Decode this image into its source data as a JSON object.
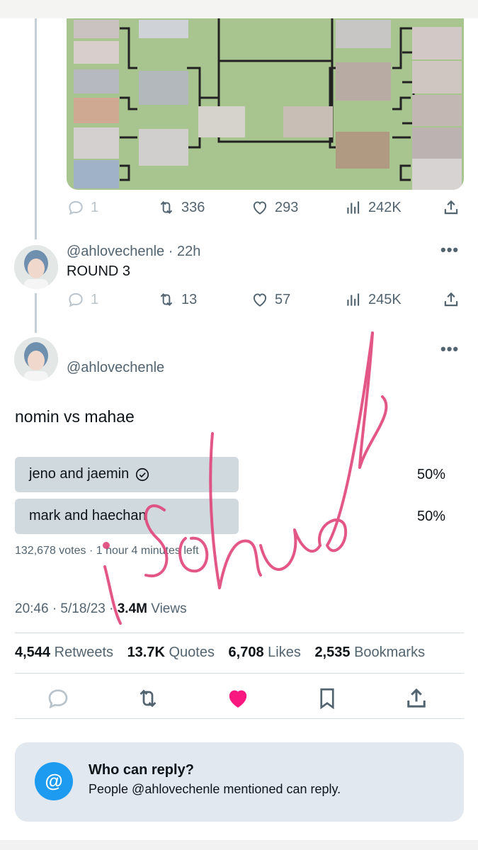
{
  "first_tweet": {
    "actions": {
      "replies": "1",
      "retweets": "336",
      "likes": "293",
      "views": "242K"
    }
  },
  "round_tweet": {
    "handle": "@ahlovechenle",
    "separator": " · ",
    "time_ago": "22h",
    "text": "ROUND 3",
    "actions": {
      "replies": "1",
      "retweets": "13",
      "likes": "57",
      "views": "245K"
    }
  },
  "main_tweet": {
    "handle": "@ahlovechenle",
    "text": "nomin vs mahae",
    "poll": {
      "options": [
        {
          "label": "jeno and jaemin",
          "percent": "50%",
          "fill": 0.5,
          "voted": true
        },
        {
          "label": "mark and haechan",
          "percent": "50%",
          "fill": 0.5,
          "voted": false
        }
      ],
      "votes_text": "132,678 votes · 1 hour 4 minutes left"
    },
    "time": "20:46 · 5/18/23 · ",
    "views_count": "3.4M",
    "views_label": " Views",
    "stats": {
      "retweets_count": "4,544",
      "retweets_label": "Retweets",
      "quotes_count": "13.7K",
      "quotes_label": "Quotes",
      "likes_count": "6,708",
      "likes_label": "Likes",
      "bookmarks_count": "2,535",
      "bookmarks_label": "Bookmarks"
    }
  },
  "reply_card": {
    "icon_symbol": "@",
    "title": "Who can reply?",
    "subtitle": "People @ahlovechenle mentioned can reply."
  },
  "watermark_text": "isohua",
  "colors": {
    "bracket_bg": "#a8c48f",
    "like_active": "#f91880",
    "accent": "#1d9bf0",
    "watermark": "#e0457b"
  },
  "icons": [
    "reply-icon",
    "retweet-icon",
    "like-icon",
    "views-icon",
    "share-icon",
    "more-icon",
    "bookmark-icon",
    "check-circle-icon",
    "at-icon"
  ]
}
